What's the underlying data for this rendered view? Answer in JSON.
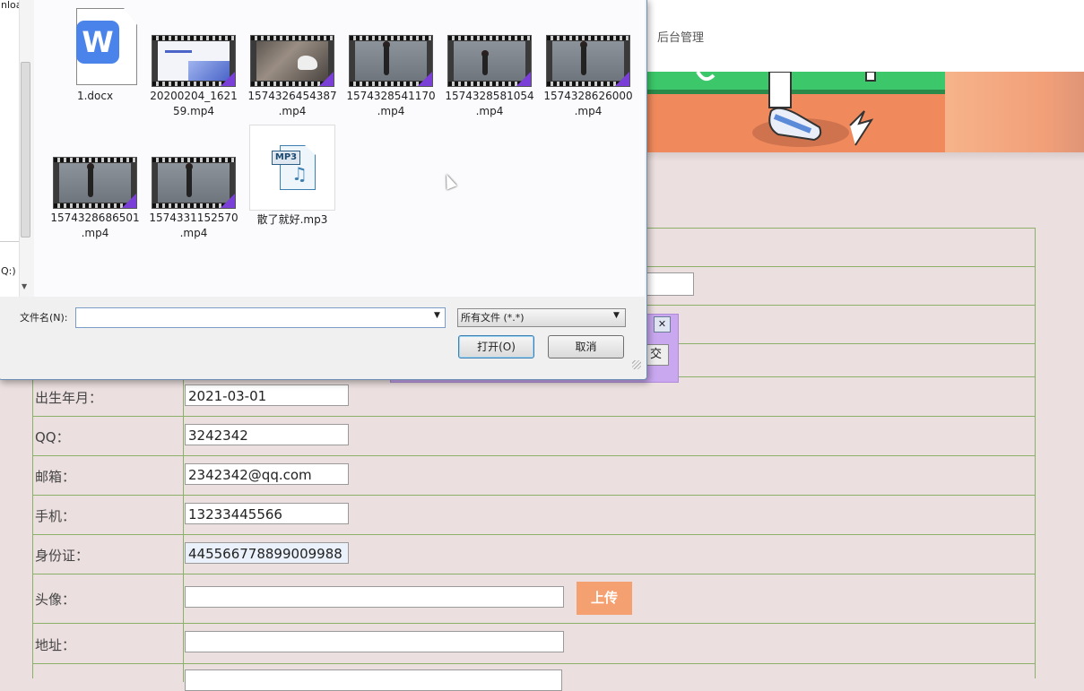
{
  "page": {
    "nav": {
      "admin": "后台管理"
    },
    "form": {
      "rows": [
        {
          "label": "出生年月：",
          "value": "2021-03-01"
        },
        {
          "label": "QQ：",
          "value": "3242342"
        },
        {
          "label": "邮箱：",
          "value": "2342342@qq.com"
        },
        {
          "label": "手机：",
          "value": "13233445566"
        },
        {
          "label": "身份证：",
          "value": "445566778899009988"
        },
        {
          "label": "头像：",
          "value": ""
        },
        {
          "label": "地址：",
          "value": ""
        }
      ],
      "upload_label": "上传"
    },
    "popup": {
      "close_label": "✕",
      "submit_partial": "交"
    }
  },
  "dialog": {
    "left_pane": {
      "item_top": "nloa",
      "item_drive": "Q:)"
    },
    "files": [
      {
        "name": "1.docx",
        "kind": "docx",
        "icon": "wps-writer-icon"
      },
      {
        "name": "20200204_162159.mp4",
        "line1": "20200204_1621",
        "line2": "59.mp4",
        "kind": "video-slide"
      },
      {
        "name": "1574326454387.mp4",
        "line1": "1574326454387",
        "line2": ".mp4",
        "kind": "video-rock"
      },
      {
        "name": "1574328541170.mp4",
        "line1": "1574328541170",
        "line2": ".mp4",
        "kind": "video"
      },
      {
        "name": "1574328581054.mp4",
        "line1": "1574328581054",
        "line2": ".mp4",
        "kind": "video"
      },
      {
        "name": "1574328626000.mp4",
        "line1": "1574328626000",
        "line2": ".mp4",
        "kind": "video"
      },
      {
        "name": "1574328686501.mp4",
        "line1": "1574328686501",
        "line2": ".mp4",
        "kind": "video"
      },
      {
        "name": "1574331152570.mp4",
        "line1": "1574331152570",
        "line2": ".mp4",
        "kind": "video"
      },
      {
        "name": "散了就好.mp3",
        "kind": "mp3",
        "tag": "MP3"
      }
    ],
    "filename_label": "文件名(N):",
    "filename_value": "",
    "filter_value": "所有文件 (*.*)",
    "open_label": "打开(O)",
    "cancel_label": "取消"
  },
  "colors": {
    "page_bg": "#ebdfdf",
    "table_border": "#8bb06a",
    "upload_button": "#f5a070",
    "popup_bg": "#c9a8f0"
  }
}
